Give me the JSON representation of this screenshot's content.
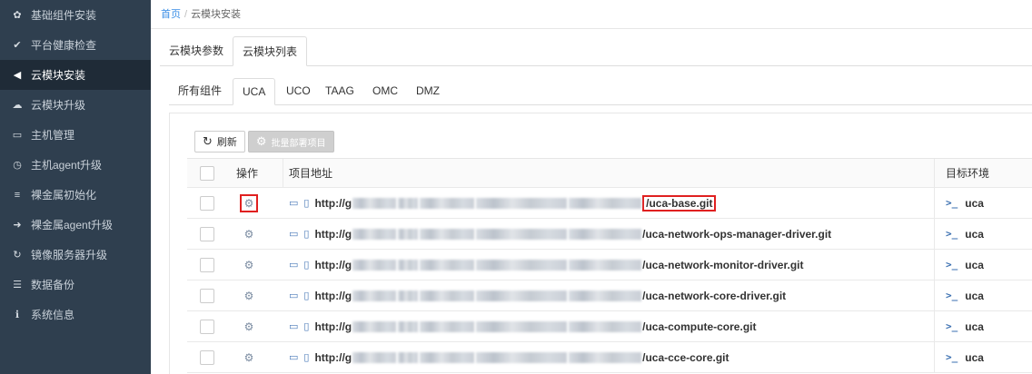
{
  "sidebar": {
    "items": [
      {
        "label": "基础组件安装",
        "icon": "gear-icon",
        "glyph": "✿",
        "active": false
      },
      {
        "label": "平台健康检查",
        "icon": "check-icon",
        "glyph": "✔",
        "active": false
      },
      {
        "label": "云模块安装",
        "icon": "send-icon",
        "glyph": "◀",
        "active": true
      },
      {
        "label": "云模块升级",
        "icon": "cloud-upload-icon",
        "glyph": "☁",
        "active": false
      },
      {
        "label": "主机管理",
        "icon": "monitor-icon",
        "glyph": "▭",
        "active": false
      },
      {
        "label": "主机agent升级",
        "icon": "clock-icon",
        "glyph": "◷",
        "active": false
      },
      {
        "label": "裸金属初始化",
        "icon": "server-icon",
        "glyph": "≡",
        "active": false
      },
      {
        "label": "裸金属agent升级",
        "icon": "arrow-circle-icon",
        "glyph": "➜",
        "active": false
      },
      {
        "label": "镜像服务器升级",
        "icon": "refresh-icon",
        "glyph": "↻",
        "active": false
      },
      {
        "label": "数据备份",
        "icon": "database-icon",
        "glyph": "☰",
        "active": false
      },
      {
        "label": "系统信息",
        "icon": "info-icon",
        "glyph": "ℹ",
        "active": false
      }
    ]
  },
  "breadcrumb": {
    "home": "首页",
    "separator": "/",
    "current": "云模块安装"
  },
  "outer_tabs": [
    {
      "label": "云模块参数",
      "active": false
    },
    {
      "label": "云模块列表",
      "active": true
    }
  ],
  "inner_tabs": [
    {
      "label": "所有组件",
      "active": false
    },
    {
      "label": "UCA",
      "active": true
    },
    {
      "label": "UCO",
      "active": false
    },
    {
      "label": "TAAG",
      "active": false
    },
    {
      "label": "OMC",
      "active": false
    },
    {
      "label": "DMZ",
      "active": false
    }
  ],
  "toolbar": {
    "refresh_label": "刷新",
    "refresh_icon": "refresh-icon",
    "batch_deploy_label": "批量部署项目",
    "batch_deploy_icon": "gears-icon"
  },
  "table": {
    "columns": {
      "op": "操作",
      "url": "项目地址",
      "env": "目标环境"
    },
    "rows": [
      {
        "url_prefix": "http://g",
        "url_suffix": "/uca-base.git",
        "env": "uca",
        "highlighted": true
      },
      {
        "url_prefix": "http://g",
        "url_suffix": "/uca-network-ops-manager-driver.git",
        "env": "uca",
        "highlighted": false
      },
      {
        "url_prefix": "http://g",
        "url_suffix": "/uca-network-monitor-driver.git",
        "env": "uca",
        "highlighted": false
      },
      {
        "url_prefix": "http://g",
        "url_suffix": "/uca-network-core-driver.git",
        "env": "uca",
        "highlighted": false
      },
      {
        "url_prefix": "http://g",
        "url_suffix": "/uca-compute-core.git",
        "env": "uca",
        "highlighted": false
      },
      {
        "url_prefix": "http://g",
        "url_suffix": "/uca-cce-core.git",
        "env": "uca",
        "highlighted": false
      }
    ]
  },
  "colors": {
    "sidebar_bg": "#2f3f4f",
    "sidebar_active": "#1f2b37",
    "link": "#3a8ee6",
    "highlight": "#e02020"
  }
}
